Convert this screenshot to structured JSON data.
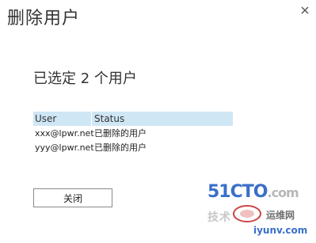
{
  "dialog": {
    "title": "删除用户",
    "subtitle": "已选定 2 个用户",
    "close_button_label": "关闭"
  },
  "table": {
    "columns": [
      "User",
      "Status"
    ],
    "rows": [
      {
        "user": "xxx@lpwr.net",
        "status": "已删除的用户"
      },
      {
        "user": "yyy@lpwr.net",
        "status": "已删除的用户"
      }
    ]
  },
  "watermark": {
    "brand": "51CTO",
    "brand_suffix": ".com",
    "tagline_1": "技术",
    "tagline_2": "运维网",
    "url": "iyunv.com"
  },
  "colors": {
    "header_bg": "#cfe6f5",
    "watermark_blue": "#3a6fc8"
  }
}
